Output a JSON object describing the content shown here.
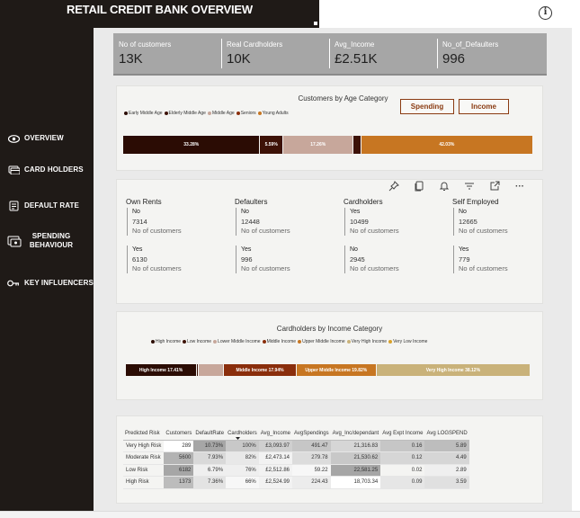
{
  "app": {
    "title": "RETAIL CREDIT BANK OVERVIEW",
    "info_icon": "info-icon"
  },
  "sidebar": {
    "items": [
      {
        "label": "OVERVIEW",
        "icon": "eye-icon"
      },
      {
        "label": "CARD HOLDERS",
        "icon": "card-icon"
      },
      {
        "label": "DEFAULT RATE",
        "icon": "report-icon"
      },
      {
        "label": "SPENDING BEHAVIOUR",
        "icon": "spending-icon"
      },
      {
        "label": "KEY INFLUENCERS",
        "icon": "key-icon"
      }
    ]
  },
  "kpis": [
    {
      "label": "No of customers",
      "value": "13K"
    },
    {
      "label": "Real Cardholders",
      "value": "10K"
    },
    {
      "label": "Avg_Income",
      "value": "£2.51K"
    },
    {
      "label": "No_of_Defaulters",
      "value": "996"
    }
  ],
  "age_chart": {
    "title": "Customers by Age Category",
    "legend": [
      {
        "name": "Early Middle Age",
        "color": "#2b0c04"
      },
      {
        "name": "Elderly Middle Age",
        "color": "#3d1207"
      },
      {
        "name": "Middle Age",
        "color": "#c7a79b"
      },
      {
        "name": "Seniors",
        "color": "#8a2e0c"
      },
      {
        "name": "Young Adults",
        "color": "#c77622"
      }
    ],
    "segments": [
      {
        "name": "Early Middle Age",
        "value": 33.28,
        "label": "33.28%",
        "color": "#2b0c04"
      },
      {
        "name": "Elderly Middle Age",
        "value": 5.59,
        "label": "5.59%",
        "color": "#3d1207"
      },
      {
        "name": "Middle Age",
        "value": 17.26,
        "label": "17.26%",
        "color": "#c7a79b"
      },
      {
        "name": "Seniors",
        "value": 1.8,
        "label": "",
        "color": "#3d1207"
      },
      {
        "name": "Young Adults",
        "value": 42.03,
        "label": "42.03%",
        "color": "#c77622"
      }
    ],
    "buttons": [
      "Spending",
      "Income"
    ]
  },
  "toolbar": [
    "pin-icon",
    "copy-icon",
    "bell-icon",
    "filter-icon",
    "expand-icon",
    "more-icon"
  ],
  "stats": [
    {
      "title": "Own Rents",
      "a_key": "No",
      "a_val": "7314",
      "a_sub": "No of customers",
      "b_key": "Yes",
      "b_val": "6130",
      "b_sub": "No of customers"
    },
    {
      "title": "Defaulters",
      "a_key": "No",
      "a_val": "12448",
      "a_sub": "No of customers",
      "b_key": "Yes",
      "b_val": "996",
      "b_sub": "No of customers"
    },
    {
      "title": "Cardholders",
      "a_key": "Yes",
      "a_val": "10499",
      "a_sub": "No of customers",
      "b_key": "No",
      "b_val": "2945",
      "b_sub": "No of customers"
    },
    {
      "title": "Self Employed",
      "a_key": "No",
      "a_val": "12665",
      "a_sub": "No of customers",
      "b_key": "Yes",
      "b_val": "779",
      "b_sub": "No of customers"
    }
  ],
  "income_chart": {
    "title": "Cardholders by Income Category",
    "legend": [
      {
        "name": "High Income",
        "color": "#2b0c04"
      },
      {
        "name": "Low Income",
        "color": "#3d1207"
      },
      {
        "name": "Lower Middle Income",
        "color": "#c7a79b"
      },
      {
        "name": "Middle Income",
        "color": "#8a2e0c"
      },
      {
        "name": "Upper Middle Income",
        "color": "#c77622"
      },
      {
        "name": "Very High Income",
        "color": "#c9b27a"
      },
      {
        "name": "Very Low Income",
        "color": "#d9a12a"
      }
    ],
    "segments": [
      {
        "name": "High Income",
        "value": 17.41,
        "label": "High Income 17.41%",
        "color": "#2b0c04"
      },
      {
        "name": "Low Income",
        "value": 0.3,
        "label": "",
        "color": "#3d1207"
      },
      {
        "name": "Lower Middle Income",
        "value": 6.4,
        "label": "",
        "color": "#c7a79b"
      },
      {
        "name": "Middle Income",
        "value": 17.94,
        "label": "Middle Income 17.94%",
        "color": "#8a2e0c"
      },
      {
        "name": "Upper Middle Income",
        "value": 19.82,
        "label": "Upper Middle Income 19.82%",
        "color": "#c77622"
      },
      {
        "name": "Very High Income",
        "value": 38.12,
        "label": "Very High Income 38.12%",
        "color": "#c9b27a"
      }
    ]
  },
  "risk_table": {
    "columns": [
      "Predicted Risk",
      "Customers",
      "DefaultRate",
      "Cardholders",
      "Avg_Income",
      "AvgSpendings",
      "Avg_Inc/dependant",
      "Avg Expt Income",
      "Avg LOGSPEND"
    ],
    "rows": [
      [
        "Very High Risk",
        "289",
        "10.73%",
        "100%",
        "£3,093.97",
        "491.47",
        "21,316.83",
        "0.16",
        "5.89"
      ],
      [
        "Moderate Risk",
        "5600",
        "7.93%",
        "82%",
        "£2,473.14",
        "279.78",
        "21,530.62",
        "0.12",
        "4.49"
      ],
      [
        "Low Risk",
        "6182",
        "6.79%",
        "76%",
        "£2,512.86",
        "59.22",
        "22,581.25",
        "0.02",
        "2.89"
      ],
      [
        "High Risk",
        "1373",
        "7.36%",
        "66%",
        "£2,524.99",
        "224.43",
        "18,703.34",
        "0.09",
        "3.59"
      ]
    ]
  }
}
